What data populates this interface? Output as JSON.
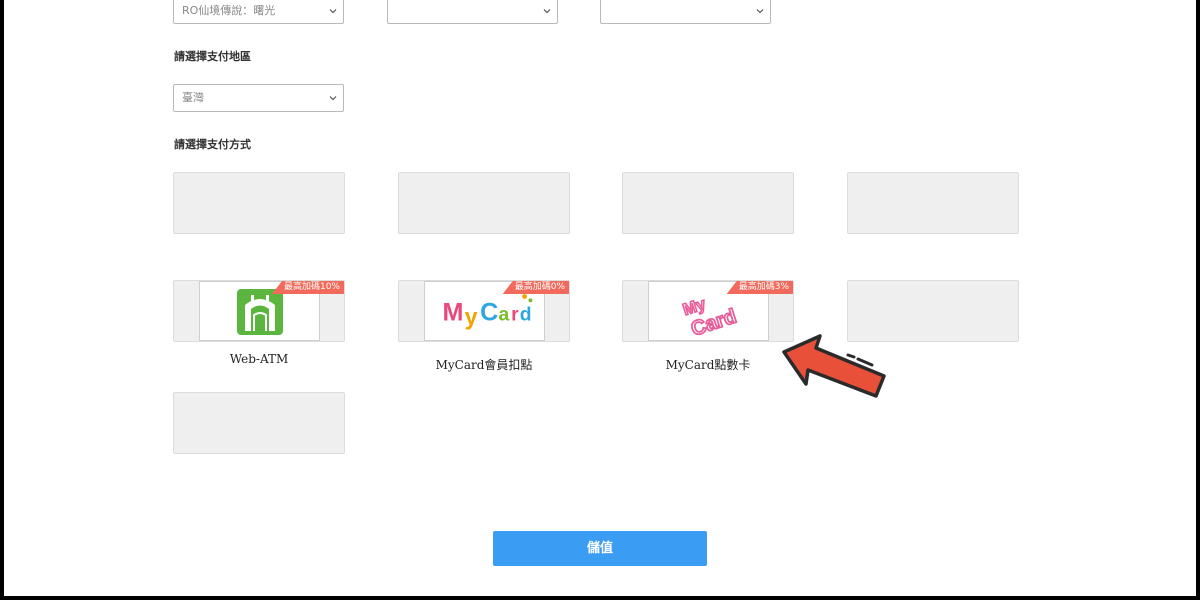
{
  "selects": {
    "game": {
      "value": "RO仙境傳說：曙光"
    },
    "server": {
      "value": ""
    },
    "role": {
      "value": ""
    },
    "region": {
      "value": "臺灣"
    }
  },
  "labels": {
    "region": "請選擇支付地區",
    "method": "請選擇支付方式"
  },
  "payment_methods": [
    {
      "caption": "Web-ATM",
      "badge": "最高加碼10%",
      "logo": "web-atm-logo"
    },
    {
      "caption": "MyCard會員扣點",
      "badge": "最高加碼0%",
      "logo": "mycard-logo",
      "logo_text": "MyCard"
    },
    {
      "caption": "MyCard點數卡",
      "badge": "最高加碼3%",
      "logo": "mycard-card-logo",
      "logo_text": [
        "My",
        "Card"
      ]
    }
  ],
  "button": {
    "submit": "儲值"
  },
  "colors": {
    "primary": "#3a9cf3",
    "badge": "#f26a5b",
    "arrow": "#e8503a",
    "atm_green": "#5cb53f"
  }
}
